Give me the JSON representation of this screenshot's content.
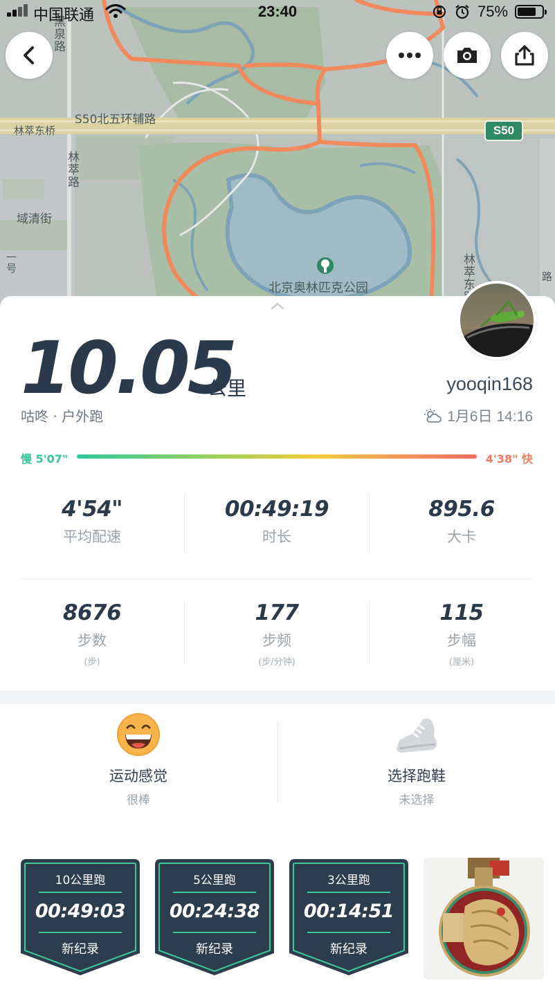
{
  "status_bar": {
    "carrier": "中国联通",
    "time": "23:40",
    "battery_percent": "75%",
    "battery_level": 0.75
  },
  "map": {
    "labels": {
      "ring_road": "S50北五环辅路",
      "park": "北京奥林匹克公园",
      "lincui_bridge": "林萃东桥",
      "lincui_road": "林萃路",
      "yuqing_street": "域清街",
      "heiquan_road": "黑泉路",
      "lincui_east": "林萃东路",
      "shield": "S50",
      "left_edge": "一号",
      "right_edge": "路"
    },
    "route_color": "#f08a5d"
  },
  "summary": {
    "distance": "10.05",
    "distance_unit": "公里",
    "activity": "咕咚 · 户外跑",
    "username": "yooqin168",
    "datetime": "1月6日 14:16"
  },
  "pace_range": {
    "slow_label": "慢 5'07\"",
    "fast_label": "4'38\" 快",
    "slow_color": "#33c79b",
    "fast_color": "#ef7b62"
  },
  "stats": [
    {
      "value": "4'54\"",
      "label": "平均配速",
      "sub": ""
    },
    {
      "value": "00:49:19",
      "label": "时长",
      "sub": ""
    },
    {
      "value": "895.6",
      "label": "大卡",
      "sub": ""
    },
    {
      "value": "8676",
      "label": "步数",
      "sub": "(步)"
    },
    {
      "value": "177",
      "label": "步频",
      "sub": "(步/分钟)"
    },
    {
      "value": "115",
      "label": "步幅",
      "sub": "(厘米)"
    }
  ],
  "feeling": {
    "title": "运动感觉",
    "value": "很棒",
    "icon": "grinning-face-icon"
  },
  "shoes": {
    "title": "选择跑鞋",
    "value": "未选择",
    "icon": "running-shoe-icon"
  },
  "badges": [
    {
      "title": "10公里跑",
      "time": "00:49:03",
      "tag": "新纪录"
    },
    {
      "title": "5公里跑",
      "time": "00:24:38",
      "tag": "新纪录"
    },
    {
      "title": "3公里跑",
      "time": "00:14:51",
      "tag": "新纪录"
    }
  ],
  "colors": {
    "badge_bg": "#2c3e4e",
    "badge_accent": "#3fc79a",
    "text_primary": "#2b3a4b"
  }
}
